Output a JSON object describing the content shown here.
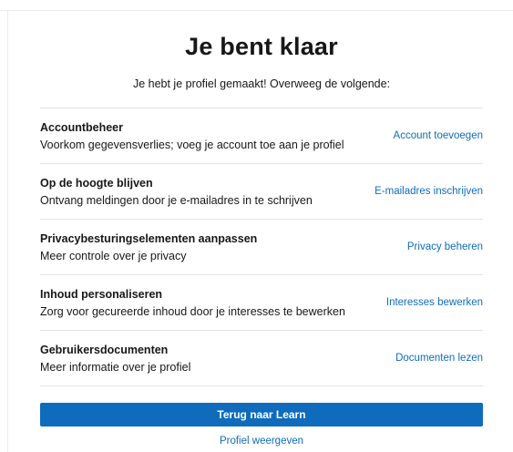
{
  "page": {
    "title": "Je bent klaar",
    "subtitle": "Je hebt je profiel gemaakt! Overweeg de volgende:"
  },
  "items": [
    {
      "heading": "Accountbeheer",
      "description": "Voorkom gegevensverlies; voeg je account toe aan je profiel",
      "action": "Account toevoegen"
    },
    {
      "heading": "Op de hoogte blijven",
      "description": "Ontvang meldingen door je e-mailadres in te schrijven",
      "action": "E-mailadres inschrijven"
    },
    {
      "heading": "Privacybesturingselementen aanpassen",
      "description": "Meer controle over je privacy",
      "action": "Privacy beheren"
    },
    {
      "heading": "Inhoud personaliseren",
      "description": "Zorg voor gecureerde inhoud door je interesses te bewerken",
      "action": "Interesses bewerken"
    },
    {
      "heading": "Gebruikersdocumenten",
      "description": "Meer informatie over je profiel",
      "action": "Documenten lezen"
    }
  ],
  "buttons": {
    "primary": "Terug naar Learn",
    "secondary": "Profiel weergeven"
  },
  "colors": {
    "accent": "#0f6cbd",
    "divider": "#e3e3e3",
    "text": "#171717"
  }
}
